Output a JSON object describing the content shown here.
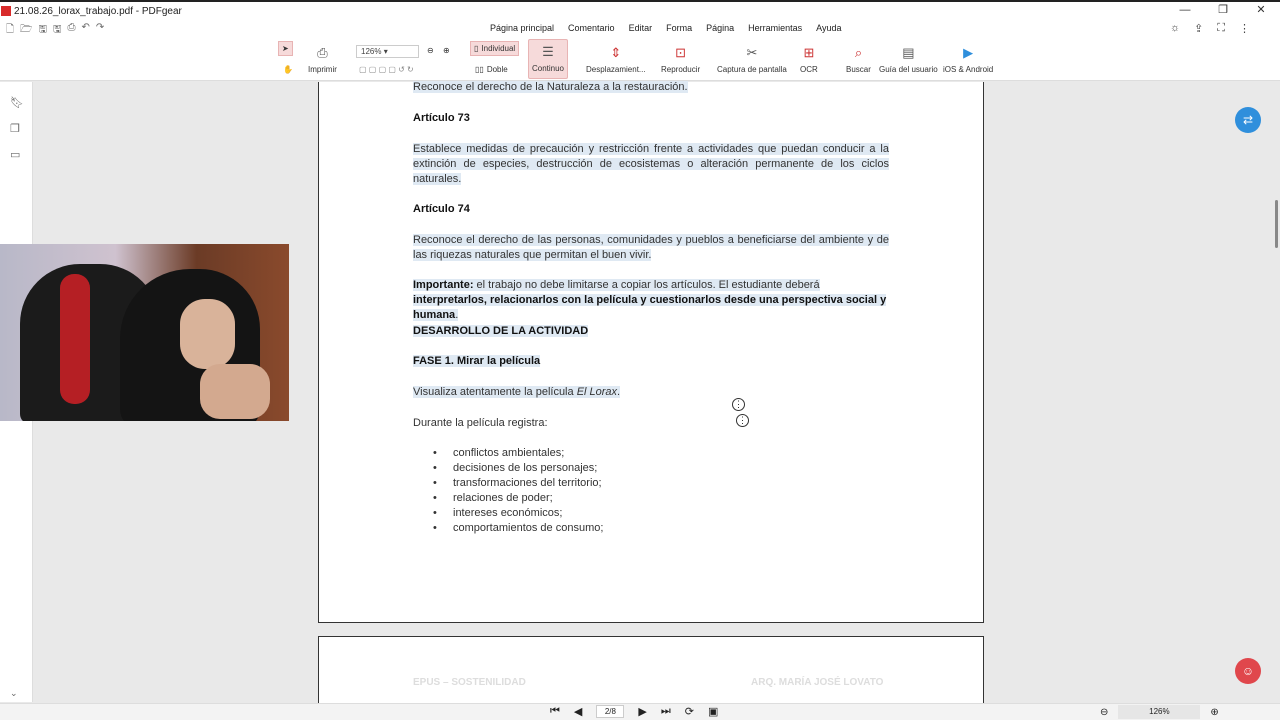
{
  "window": {
    "title": "21.08.26_lorax_trabajo.pdf - PDFgear",
    "controls": [
      "—",
      "❐",
      "✕"
    ]
  },
  "quick_access": [
    "🗋",
    "🗁",
    "🖫",
    "🖫",
    "⎙",
    "↶",
    "↷"
  ],
  "menu": {
    "tabs": [
      "Página principal",
      "Comentario",
      "Editar",
      "Forma",
      "Página",
      "Herramientas",
      "Ayuda"
    ],
    "active": "Página principal"
  },
  "ribbon": {
    "print": "Imprimir",
    "zoom": "126%",
    "view_single": "Individual",
    "view_double": "Doble",
    "continuous": "Continuo",
    "scroll": "Desplazamient...",
    "play": "Reproducir",
    "screenshot": "Captura de pantalla",
    "ocr": "OCR",
    "search": "Buscar",
    "guide": "Guía del usuario",
    "mobile": "iOS & Android"
  },
  "document": {
    "line1": "Reconoce el derecho de la Naturaleza a la restauración.",
    "art73_title": "Artículo 73",
    "art73_text": "Establece medidas de precaución y restricción frente a actividades que puedan conducir a la extinción de especies, destrucción de ecosistemas o alteración permanente de los ciclos naturales.",
    "art74_title": "Artículo 74",
    "art74_text": "Reconoce el derecho de las personas, comunidades y pueblos a beneficiarse del ambiente y de las riquezas naturales que permitan el buen vivir.",
    "important_label": "Importante:",
    "important_text": " el trabajo no debe limitarse a copiar los artículos. El estudiante deberá ",
    "important_bold": "interpretarlos, relacionarlos con la película y cuestionarlos desde una perspectiva social y humana",
    "important_end": ".",
    "desarrollo": "DESARROLLO DE LA ACTIVIDAD",
    "fase1": "FASE 1. Mirar la película",
    "visualiza_pre": "Visualiza atentamente la película ",
    "visualiza_italic": "El Lorax",
    "visualiza_end": ".",
    "durante": "Durante la película registra:",
    "items": [
      "conflictos ambientales;",
      "decisiones de los personajes;",
      "transformaciones del territorio;",
      "relaciones de poder;",
      "intereses económicos;",
      "comportamientos de consumo;"
    ],
    "page2_header_left": "EPUS – SOSTENILIDAD",
    "page2_header_right": "ARQ. MARÍA JOSÉ LOVATO"
  },
  "status": {
    "page": "2/8",
    "zoom": "126%"
  },
  "colors": {
    "accent": "#d33333",
    "highlight": "#dfe9f3",
    "fab_blue": "#2f8fdc",
    "fab_red": "#e0474c"
  }
}
